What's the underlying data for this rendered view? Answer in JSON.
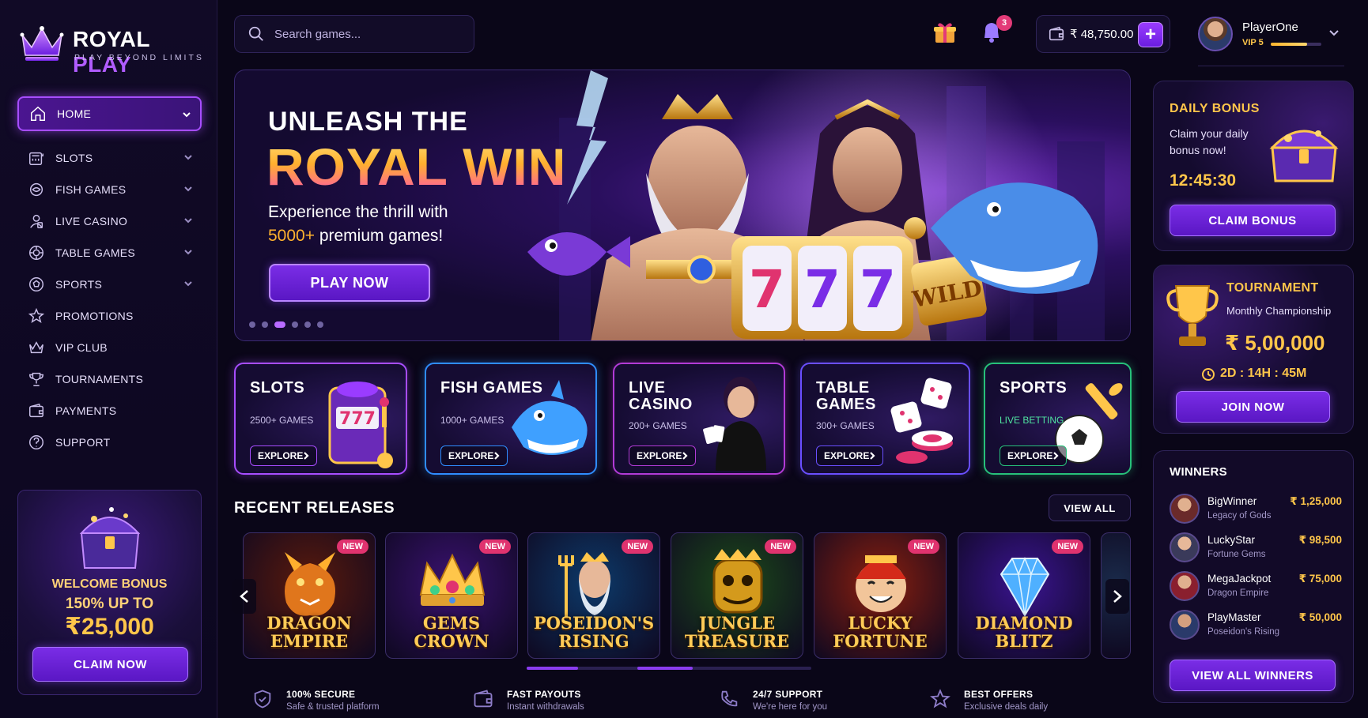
{
  "brand": {
    "name_white": "ROYAL",
    "name_purple": "PLAY",
    "tagline": "PLAY BEYOND LIMITS"
  },
  "sidebar": {
    "items": [
      {
        "label": "HOME",
        "icon": "home-icon",
        "active": true,
        "has_chevron": true
      },
      {
        "label": "SLOTS",
        "icon": "slot-machine-icon",
        "has_chevron": true
      },
      {
        "label": "FISH GAMES",
        "icon": "fish-icon",
        "has_chevron": true
      },
      {
        "label": "LIVE CASINO",
        "icon": "live-dealer-icon",
        "has_chevron": true
      },
      {
        "label": "TABLE GAMES",
        "icon": "chip-icon",
        "has_chevron": true
      },
      {
        "label": "SPORTS",
        "icon": "ball-icon",
        "has_chevron": true
      },
      {
        "label": "PROMOTIONS",
        "icon": "star-icon",
        "has_chevron": false
      },
      {
        "label": "VIP CLUB",
        "icon": "crown-icon",
        "has_chevron": false
      },
      {
        "label": "TOURNAMENTS",
        "icon": "trophy-icon",
        "has_chevron": false
      },
      {
        "label": "PAYMENTS",
        "icon": "wallet-icon",
        "has_chevron": false
      },
      {
        "label": "SUPPORT",
        "icon": "question-icon",
        "has_chevron": false
      }
    ],
    "welcome": {
      "line1": "WELCOME BONUS",
      "line2": "150% UP TO",
      "amount": "₹25,000",
      "button": "CLAIM NOW"
    }
  },
  "topbar": {
    "search_placeholder": "Search games...",
    "notifications_count": "3",
    "balance": "₹ 48,750.00",
    "add_funds": "+",
    "user": {
      "name": "PlayerOne",
      "vip": "VIP 5",
      "vip_progress": 0.72
    }
  },
  "hero": {
    "line1": "UNLEASH THE",
    "line2": "ROYAL WIN",
    "sub1": "Experience the thrill with",
    "sub2_highlight": "5000+",
    "sub2_rest": " premium games!",
    "button": "PLAY NOW",
    "slides": 6,
    "active_slide": 2
  },
  "categories": [
    {
      "title1": "SLOTS",
      "title2": "",
      "sub": "2500+ GAMES",
      "button": "EXPLORE",
      "color": "#a74dff"
    },
    {
      "title1": "FISH GAMES",
      "title2": "",
      "sub": "1000+ GAMES",
      "button": "EXPLORE",
      "color": "#2f8dff"
    },
    {
      "title1": "LIVE",
      "title2": "CASINO",
      "sub": "200+ GAMES",
      "button": "EXPLORE",
      "color": "#b23bd6"
    },
    {
      "title1": "TABLE",
      "title2": "GAMES",
      "sub": "300+ GAMES",
      "button": "EXPLORE",
      "color": "#6a4fff"
    },
    {
      "title1": "SPORTS",
      "title2": "",
      "sub": "LIVE BETTING",
      "button": "EXPLORE",
      "color": "#27c07a"
    }
  ],
  "recent": {
    "title": "RECENT RELEASES",
    "view_all": "VIEW ALL",
    "games": [
      {
        "line1": "DRAGON",
        "line2": "EMPIRE",
        "badge": "NEW",
        "bg": "#5a1a0c"
      },
      {
        "line1": "GEMS",
        "line2": "CROWN",
        "badge": "NEW",
        "bg": "#3a1270"
      },
      {
        "line1": "POSEIDON'S",
        "line2": "RISING",
        "badge": "NEW",
        "bg": "#0d3a6a"
      },
      {
        "line1": "JUNGLE",
        "line2": "TREASURE",
        "badge": "NEW",
        "bg": "#1c4a1a"
      },
      {
        "line1": "LUCKY",
        "line2": "FORTUNE",
        "badge": "NEW",
        "bg": "#8a1f0e"
      },
      {
        "line1": "DIAMOND",
        "line2": "BLITZ",
        "badge": "NEW",
        "bg": "#3a1490"
      }
    ]
  },
  "features": [
    {
      "title": "100% SECURE",
      "sub": "Safe & trusted platform",
      "icon": "shield-icon"
    },
    {
      "title": "FAST PAYOUTS",
      "sub": "Instant withdrawals",
      "icon": "wallet-icon"
    },
    {
      "title": "24/7 SUPPORT",
      "sub": "We're here for you",
      "icon": "phone-icon"
    },
    {
      "title": "BEST OFFERS",
      "sub": "Exclusive deals daily",
      "icon": "star-icon"
    }
  ],
  "daily": {
    "title": "DAILY BONUS",
    "text": "Claim your daily bonus now!",
    "timer": "12:45:30",
    "button": "CLAIM BONUS"
  },
  "tournament": {
    "title": "TOURNAMENT",
    "sub": "Monthly Championship",
    "prize": "₹ 5,00,000",
    "countdown": "2D : 14H : 45M",
    "button": "JOIN NOW"
  },
  "winners": {
    "title": "WINNERS",
    "rows": [
      {
        "name": "BigWinner",
        "game": "Legacy of Gods",
        "amount": "₹ 1,25,000"
      },
      {
        "name": "LuckyStar",
        "game": "Fortune Gems",
        "amount": "₹ 98,500"
      },
      {
        "name": "MegaJackpot",
        "game": "Dragon Empire",
        "amount": "₹ 75,000"
      },
      {
        "name": "PlayMaster",
        "game": "Poseidon's Rising",
        "amount": "₹ 50,000"
      }
    ],
    "button": "VIEW ALL WINNERS"
  },
  "colors": {
    "accent": "#a74dff",
    "gold": "#ffc64a",
    "bg": "#0a0618",
    "badge": "#e0336f"
  }
}
